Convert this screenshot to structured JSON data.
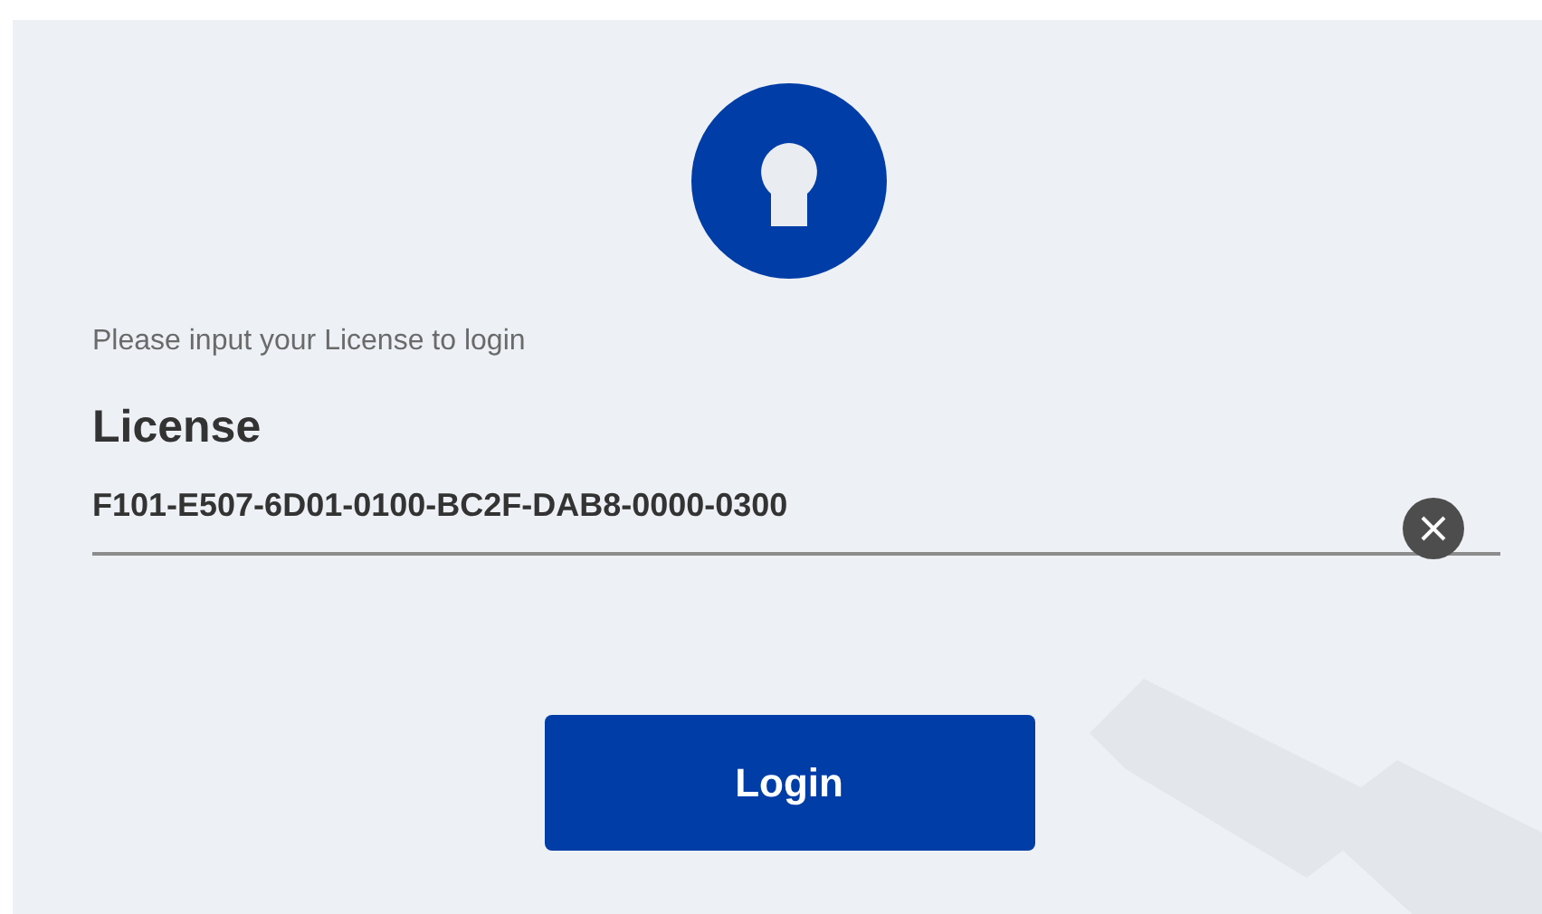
{
  "prompt": "Please input your License to login",
  "license_field": {
    "label": "License",
    "value": "F101-E507-6D01-0100-BC2F-DAB8-0000-0300"
  },
  "login_button": {
    "label": "Login"
  }
}
